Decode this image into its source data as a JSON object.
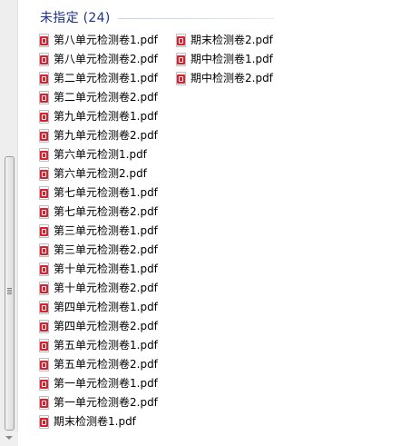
{
  "group": {
    "title": "未指定 (24)"
  },
  "icons": {
    "file_icon": "pdf-file-icon",
    "scroll_down": "chevron-down-icon"
  },
  "colors": {
    "group_title": "#1e3287",
    "pdf_badge": "#d9202c"
  },
  "files": [
    "第八单元检测卷1.pdf",
    "第八单元检测卷2.pdf",
    "第二单元检测卷1.pdf",
    "第二单元检测卷2.pdf",
    "第九单元检测卷1.pdf",
    "第九单元检测卷2.pdf",
    "第六单元检测1.pdf",
    "第六单元检测2.pdf",
    "第七单元检测卷1.pdf",
    "第七单元检测卷2.pdf",
    "第三单元检测卷1.pdf",
    "第三单元检测卷2.pdf",
    "第十单元检测卷1.pdf",
    "第十单元检测卷2.pdf",
    "第四单元检测卷1.pdf",
    "第四单元检测卷2.pdf",
    "第五单元检测卷1.pdf",
    "第五单元检测卷2.pdf",
    "第一单元检测卷1.pdf",
    "第一单元检测卷2.pdf",
    "期末检测卷1.pdf",
    "期末检测卷2.pdf",
    "期中检测卷1.pdf",
    "期中检测卷2.pdf"
  ]
}
